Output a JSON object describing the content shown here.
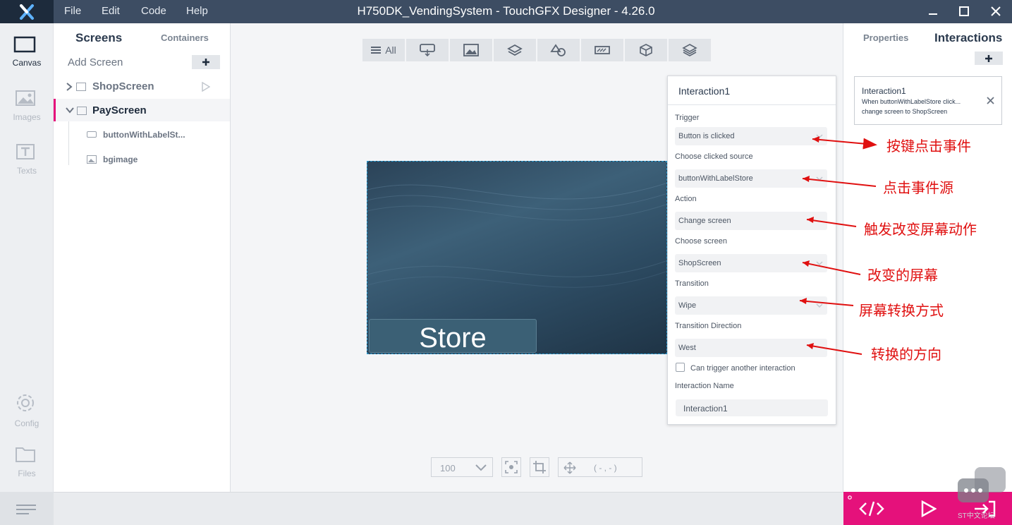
{
  "window": {
    "title": "H750DK_VendingSystem - TouchGFX Designer - 4.26.0"
  },
  "menu": {
    "file": "File",
    "edit": "Edit",
    "code": "Code",
    "help": "Help"
  },
  "leftbar": {
    "canvas": "Canvas",
    "images": "Images",
    "texts": "Texts",
    "config": "Config",
    "files": "Files"
  },
  "screens_panel": {
    "tab_screens": "Screens",
    "tab_containers": "Containers",
    "add_screen": "Add Screen",
    "items": [
      {
        "label": "ShopScreen"
      },
      {
        "label": "PayScreen"
      }
    ],
    "children": [
      {
        "label": "buttonWithLabelSt..."
      },
      {
        "label": "bgimage"
      }
    ]
  },
  "toolbar": {
    "all": "All"
  },
  "canvas": {
    "button_label": "Store"
  },
  "interaction": {
    "header": "Interaction1",
    "trigger_label": "Trigger",
    "trigger_value": "Button is clicked",
    "source_label": "Choose clicked source",
    "source_value": "buttonWithLabelStore",
    "action_label": "Action",
    "action_value": "Change screen",
    "screen_label": "Choose screen",
    "screen_value": "ShopScreen",
    "transition_label": "Transition",
    "transition_value": "Wipe",
    "direction_label": "Transition Direction",
    "direction_value": "West",
    "can_trigger": "Can trigger another interaction",
    "name_label": "Interaction Name",
    "name_value": "Interaction1"
  },
  "rightpanel": {
    "tab_properties": "Properties",
    "tab_interactions": "Interactions",
    "card_title": "Interaction1",
    "card_line1": "When buttonWithLabelStore click...",
    "card_line2": "change screen to ShopScreen"
  },
  "bottom": {
    "zoom": "100",
    "coords": "( - , - )"
  },
  "annotations": {
    "a1": "按键点击事件",
    "a2": "点击事件源",
    "a3": "触发改变屏幕动作",
    "a4": "改变的屏幕",
    "a5": "屏幕转换方式",
    "a6": "转换的方向"
  },
  "watermark": "ST中文论坛",
  "colors": {
    "titlebar": "#3d4d63",
    "accent": "#e5117b",
    "annotation": "#e01010"
  }
}
